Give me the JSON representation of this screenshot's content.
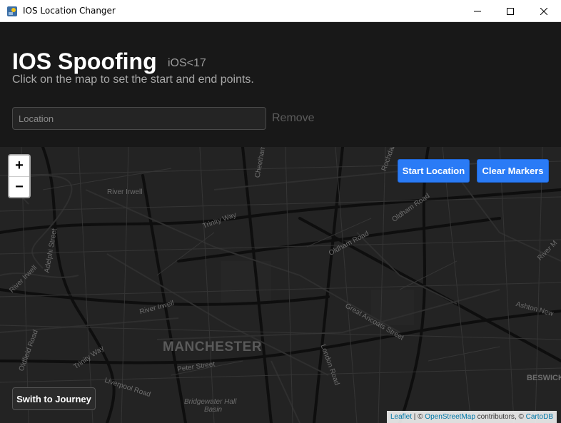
{
  "window": {
    "title": "IOS Location Changer",
    "controls": [
      "minimize",
      "maximize",
      "close"
    ]
  },
  "header": {
    "title": "IOS Spoofing",
    "version_tag": "iOS<17",
    "subtitle": "Click on the map to set the start and end points.",
    "location_placeholder": "Location",
    "remove_label": "Remove"
  },
  "map": {
    "zoom_in": "+",
    "zoom_out": "−",
    "start_location_label": "Start Location",
    "clear_markers_label": "Clear Markers",
    "journey_label": "Swith to Journey",
    "city_label": "MANCHESTER",
    "street_labels": {
      "river_irwell_top": "River Irwell",
      "trinity_way": "Trinity Way",
      "adelphi_street": "Adelphi Street",
      "river_irwell_left": "River Irwell",
      "oldham_road": "Oldham Road",
      "oldham_road_2": "Oldham Road",
      "great_ancoats": "Great Ancoats Street",
      "ashton_new": "Ashton New",
      "river_irwell_mid": "River Irwell",
      "trinity_way_2": "Trinity Way",
      "oldfield_road": "Oldfield Road",
      "peter_street": "Peter Street",
      "liverpool_road": "Liverpool Road",
      "london_road": "London Road",
      "bridgewater": "Bridgewater Hall",
      "basin": "Basin",
      "beswick": "BESWICK",
      "cheetham": "Cheetham",
      "rochdale": "Rochdale",
      "river_m": "River M"
    },
    "attribution": {
      "leaflet": "Leaflet",
      "sep1": " | © ",
      "osm": "OpenStreetMap",
      "contrib": " contributors, © ",
      "carto": "CartoDB"
    }
  },
  "colors": {
    "accent": "#2a7bf6",
    "header_bg": "#181818",
    "map_bg": "#232323"
  }
}
